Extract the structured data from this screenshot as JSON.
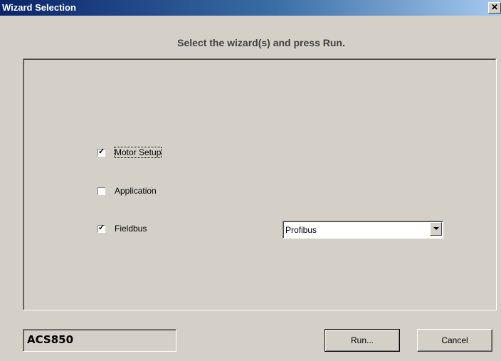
{
  "window": {
    "title": "Wizard Selection",
    "close_icon": "close-icon"
  },
  "heading": "Select the wizard(s) and press Run.",
  "wizards": [
    {
      "label": "Motor Setup",
      "checked": true
    },
    {
      "label": "Application",
      "checked": false
    },
    {
      "label": "Fieldbus",
      "checked": true
    }
  ],
  "fieldbus_select": {
    "selected": "Profibus"
  },
  "status": {
    "drive": "ACS850"
  },
  "buttons": {
    "run": "Run...",
    "cancel": "Cancel"
  }
}
